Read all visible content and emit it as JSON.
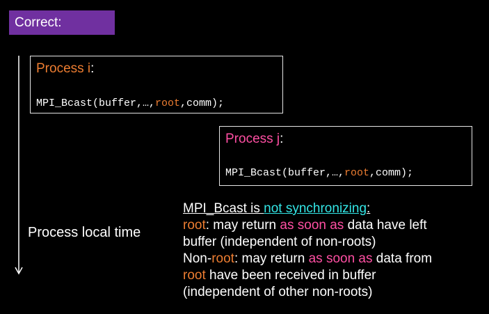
{
  "header": {
    "label": "Correct:"
  },
  "colors": {
    "badge": "#7030a0",
    "accent_orange": "#ed7d31",
    "accent_pink": "#ff4fa3",
    "accent_cyan": "#33e6e6"
  },
  "process_i": {
    "title_prefix": "Process ",
    "title_var": "i",
    "title_suffix": ":",
    "code_pre": "MPI_Bcast(buffer,…,",
    "code_arg": "root",
    "code_post": ",comm);"
  },
  "process_j": {
    "title_prefix": "Process ",
    "title_var": "j",
    "title_suffix": ":",
    "code_pre": "MPI_Bcast(buffer,…,",
    "code_arg": "root",
    "code_post": ",comm);"
  },
  "timeline": {
    "label": "Process local time",
    "arrow_icon": "down-arrow-icon"
  },
  "notes": {
    "heading_pre": "MPI_Bcast is ",
    "heading_highlight": "not synchronizing",
    "heading_post": ":",
    "line1_root": "root",
    "line1_text": ": may return ",
    "line1_emph": "as soon as",
    "line1_post": " data have left",
    "line2": "buffer (independent of non-roots)",
    "line3_pre": "Non-",
    "line3_root": "root",
    "line3_text": ": may return  ",
    "line3_emph": "as soon as",
    "line3_post": " data from",
    "line4_root": "root",
    "line4_text": " have been received in buffer",
    "line5": "(independent of other non-roots)"
  }
}
